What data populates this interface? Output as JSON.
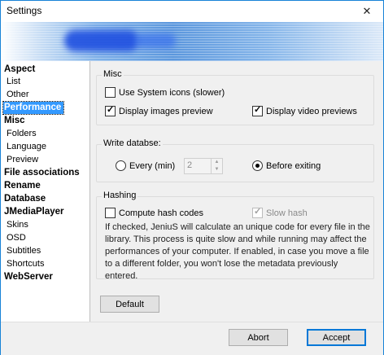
{
  "window": {
    "title": "Settings",
    "close_glyph": "✕"
  },
  "sidebar": {
    "items": [
      {
        "label": "Aspect"
      },
      {
        "label": "List"
      },
      {
        "label": "Other"
      },
      {
        "label": "Performance"
      },
      {
        "label": "Misc"
      },
      {
        "label": "Folders"
      },
      {
        "label": "Language"
      },
      {
        "label": "Preview"
      },
      {
        "label": "File associations"
      },
      {
        "label": "Rename"
      },
      {
        "label": "Database"
      },
      {
        "label": "JMediaPlayer"
      },
      {
        "label": "Skins"
      },
      {
        "label": "OSD"
      },
      {
        "label": "Subtitles"
      },
      {
        "label": "Shortcuts"
      },
      {
        "label": "WebServer"
      }
    ],
    "selected": "Performance"
  },
  "misc": {
    "label": "Misc",
    "use_system_icons": {
      "label": "Use System icons (slower)",
      "checked": false
    },
    "display_images_preview": {
      "label": "Display images preview",
      "checked": true
    },
    "display_video_previews": {
      "label": "Display video previews",
      "checked": true
    }
  },
  "write_db": {
    "label": "Write databse:",
    "every_label": "Every (min)",
    "every_value": "2",
    "before_exiting_label": "Before exiting",
    "selected": "before_exiting"
  },
  "hashing": {
    "label": "Hashing",
    "compute_hash": {
      "label": "Compute hash codes",
      "checked": false
    },
    "slow_hash": {
      "label": "Slow hash",
      "checked": true,
      "enabled": false
    },
    "description": "If checked, JeniuS will calculate an unique code for every file in the library. This process is quite slow and while running may affect the performances of your computer. If enabled, in case you move a file to a different folder, you won't lose the metadata previously entered."
  },
  "buttons": {
    "default_label": "Default",
    "abort_label": "Abort",
    "accept_label": "Accept"
  },
  "colors": {
    "accent": "#0078d7",
    "selection": "#3399ff",
    "window_bg": "#f0f0f0"
  }
}
